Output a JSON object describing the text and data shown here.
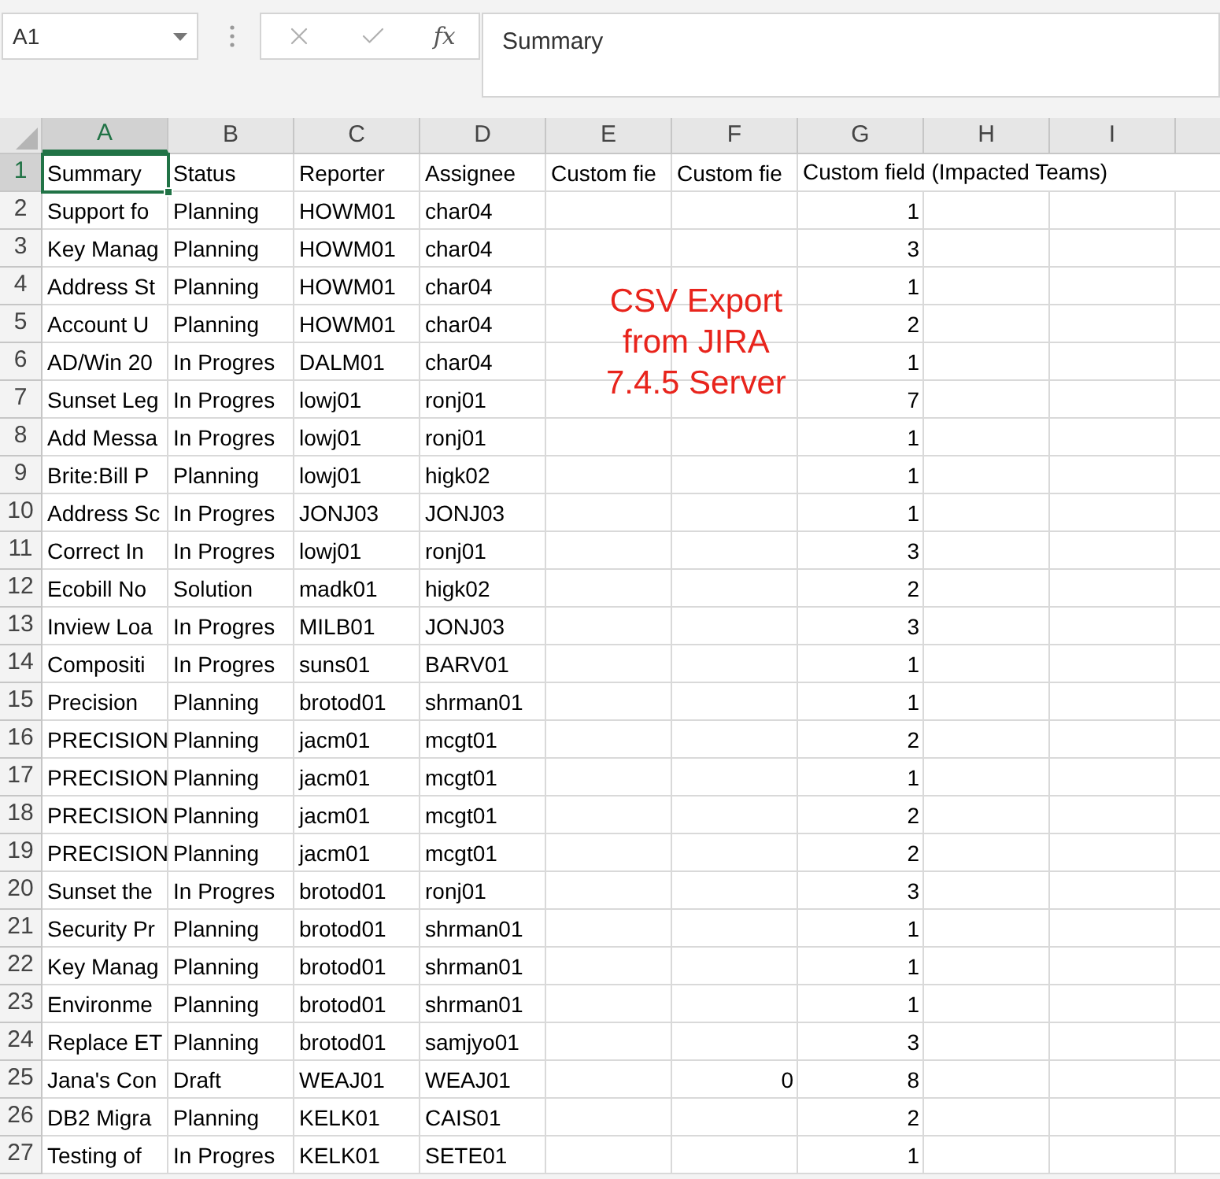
{
  "name_box": {
    "value": "A1"
  },
  "formula_bar": {
    "function_label": "fx",
    "value": "Summary"
  },
  "columns": [
    {
      "label": "A",
      "selected": true
    },
    {
      "label": "B",
      "selected": false
    },
    {
      "label": "C",
      "selected": false
    },
    {
      "label": "D",
      "selected": false
    },
    {
      "label": "E",
      "selected": false
    },
    {
      "label": "F",
      "selected": false
    },
    {
      "label": "G",
      "selected": false
    },
    {
      "label": "H",
      "selected": false
    },
    {
      "label": "I",
      "selected": false
    }
  ],
  "rows": [
    {
      "number": "1",
      "selected": true,
      "summary": "Summary",
      "status": "Status",
      "reporter": "Reporter",
      "assignee": "Assignee",
      "column_e": "Custom fie",
      "column_f": "Custom fie",
      "column_g": "Custom field (Impacted Teams)"
    },
    {
      "number": "2",
      "selected": false,
      "summary": "Support fo",
      "status": "Planning",
      "reporter": "HOWM01",
      "assignee": "char04",
      "column_g": "1"
    },
    {
      "number": "3",
      "selected": false,
      "summary": "Key Manag",
      "status": "Planning",
      "reporter": "HOWM01",
      "assignee": "char04",
      "column_g": "3"
    },
    {
      "number": "4",
      "selected": false,
      "summary": "Address St",
      "status": "Planning",
      "reporter": "HOWM01",
      "assignee": "char04",
      "column_g": "1"
    },
    {
      "number": "5",
      "selected": false,
      "summary": "Account U",
      "status": "Planning",
      "reporter": "HOWM01",
      "assignee": "char04",
      "column_g": "2"
    },
    {
      "number": "6",
      "selected": false,
      "summary": "AD/Win 20",
      "status": "In Progres",
      "reporter": "DALM01",
      "assignee": "char04",
      "column_g": "1"
    },
    {
      "number": "7",
      "selected": false,
      "summary": "Sunset Leg",
      "status": "In Progres",
      "reporter": "lowj01",
      "assignee": "ronj01",
      "column_g": "7"
    },
    {
      "number": "8",
      "selected": false,
      "summary": "Add Messa",
      "status": "In Progres",
      "reporter": "lowj01",
      "assignee": "ronj01",
      "column_g": "1"
    },
    {
      "number": "9",
      "selected": false,
      "summary": "Brite:Bill P",
      "status": "Planning",
      "reporter": "lowj01",
      "assignee": "higk02",
      "column_g": "1"
    },
    {
      "number": "10",
      "selected": false,
      "summary": "Address Sc",
      "status": "In Progres",
      "reporter": "JONJ03",
      "assignee": "JONJ03",
      "column_g": "1"
    },
    {
      "number": "11",
      "selected": false,
      "summary": "Correct In",
      "status": "In Progres",
      "reporter": "lowj01",
      "assignee": "ronj01",
      "column_g": "3"
    },
    {
      "number": "12",
      "selected": false,
      "summary": "Ecobill No",
      "status": "Solution",
      "reporter": "madk01",
      "assignee": "higk02",
      "column_g": "2"
    },
    {
      "number": "13",
      "selected": false,
      "summary": "Inview Loa",
      "status": "In Progres",
      "reporter": "MILB01",
      "assignee": "JONJ03",
      "column_g": "3"
    },
    {
      "number": "14",
      "selected": false,
      "summary": "Compositi",
      "status": "In Progres",
      "reporter": "suns01",
      "assignee": "BARV01",
      "column_g": "1"
    },
    {
      "number": "15",
      "selected": false,
      "summary": "Precision",
      "status": "Planning",
      "reporter": "brotod01",
      "assignee": "shrman01",
      "column_g": "1"
    },
    {
      "number": "16",
      "selected": false,
      "summary": "PRECISION",
      "status": "Planning",
      "reporter": "jacm01",
      "assignee": "mcgt01",
      "column_g": "2"
    },
    {
      "number": "17",
      "selected": false,
      "summary": "PRECISION",
      "status": "Planning",
      "reporter": "jacm01",
      "assignee": "mcgt01",
      "column_g": "1"
    },
    {
      "number": "18",
      "selected": false,
      "summary": "PRECISION",
      "status": "Planning",
      "reporter": "jacm01",
      "assignee": "mcgt01",
      "column_g": "2"
    },
    {
      "number": "19",
      "selected": false,
      "summary": "PRECISION",
      "status": "Planning",
      "reporter": "jacm01",
      "assignee": "mcgt01",
      "column_g": "2"
    },
    {
      "number": "20",
      "selected": false,
      "summary": "Sunset the",
      "status": "In Progres",
      "reporter": "brotod01",
      "assignee": "ronj01",
      "column_g": "3"
    },
    {
      "number": "21",
      "selected": false,
      "summary": "Security Pr",
      "status": "Planning",
      "reporter": "brotod01",
      "assignee": "shrman01",
      "column_g": "1"
    },
    {
      "number": "22",
      "selected": false,
      "summary": "Key Manag",
      "status": "Planning",
      "reporter": "brotod01",
      "assignee": "shrman01",
      "column_g": "1"
    },
    {
      "number": "23",
      "selected": false,
      "summary": "Environme",
      "status": "Planning",
      "reporter": "brotod01",
      "assignee": "shrman01",
      "column_g": "1"
    },
    {
      "number": "24",
      "selected": false,
      "summary": "Replace ET",
      "status": "Planning",
      "reporter": "brotod01",
      "assignee": "samjyo01",
      "column_g": "3"
    },
    {
      "number": "25",
      "selected": false,
      "summary": "Jana's Con",
      "status": "Draft",
      "reporter": "WEAJ01",
      "assignee": "WEAJ01",
      "column_f": "0",
      "column_g": "8"
    },
    {
      "number": "26",
      "selected": false,
      "summary": "DB2 Migra",
      "status": "Planning",
      "reporter": "KELK01",
      "assignee": "CAIS01",
      "column_g": "2"
    },
    {
      "number": "27",
      "selected": false,
      "summary": "Testing of",
      "status": "In Progres",
      "reporter": "KELK01",
      "assignee": "SETE01",
      "column_g": "1"
    }
  ],
  "overlay_note": {
    "lines": [
      "CSV Export",
      "from JIRA",
      "7.4.5 Server"
    ]
  }
}
